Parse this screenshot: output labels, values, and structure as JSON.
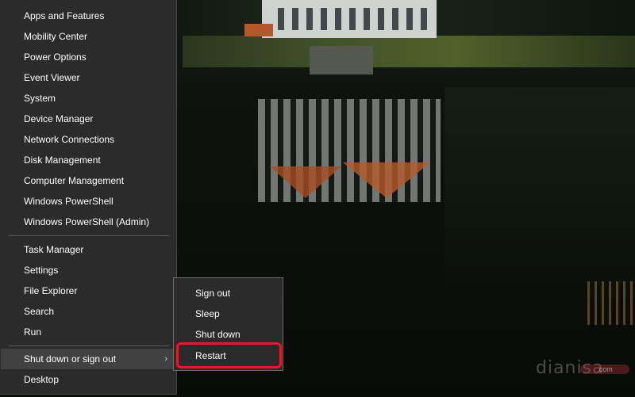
{
  "menu": {
    "items": [
      {
        "label": "Apps and Features"
      },
      {
        "label": "Mobility Center"
      },
      {
        "label": "Power Options"
      },
      {
        "label": "Event Viewer"
      },
      {
        "label": "System"
      },
      {
        "label": "Device Manager"
      },
      {
        "label": "Network Connections"
      },
      {
        "label": "Disk Management"
      },
      {
        "label": "Computer Management"
      },
      {
        "label": "Windows PowerShell"
      },
      {
        "label": "Windows PowerShell (Admin)"
      }
    ],
    "items2": [
      {
        "label": "Task Manager"
      },
      {
        "label": "Settings"
      },
      {
        "label": "File Explorer"
      },
      {
        "label": "Search"
      },
      {
        "label": "Run"
      }
    ],
    "shutdown_label": "Shut down or sign out",
    "shutdown_arrow": "›",
    "desktop_label": "Desktop"
  },
  "submenu": {
    "items": [
      {
        "label": "Sign out"
      },
      {
        "label": "Sleep"
      },
      {
        "label": "Shut down"
      },
      {
        "label": "Restart"
      }
    ]
  },
  "watermark": {
    "text": "dianisa",
    "suffix": ".com"
  },
  "colors": {
    "menu_bg": "#2b2b2b",
    "hover_bg": "#414141",
    "highlight": "#e01b2a"
  }
}
